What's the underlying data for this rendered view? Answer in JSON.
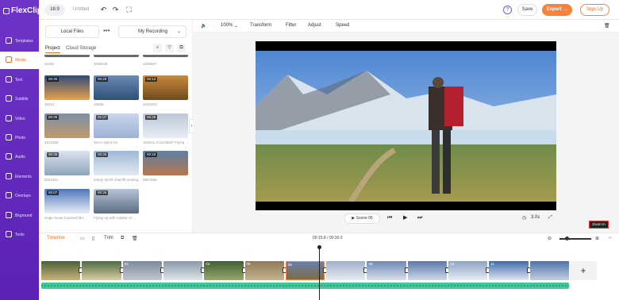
{
  "app": {
    "name": "FlexClip"
  },
  "sidebar": {
    "items": [
      {
        "label": "Templates",
        "icon": "template-icon"
      },
      {
        "label": "Media",
        "icon": "media-icon",
        "active": true
      },
      {
        "label": "Text",
        "icon": "text-icon"
      },
      {
        "label": "Subtitle",
        "icon": "subtitle-icon"
      },
      {
        "label": "Video",
        "icon": "video-icon"
      },
      {
        "label": "Photo",
        "icon": "photo-icon"
      },
      {
        "label": "Audio",
        "icon": "audio-icon"
      },
      {
        "label": "Elements",
        "icon": "elements-icon"
      },
      {
        "label": "Overlays",
        "icon": "overlays-icon"
      },
      {
        "label": "Bkground",
        "icon": "background-icon"
      },
      {
        "label": "Tools",
        "icon": "tools-icon"
      }
    ]
  },
  "topbar": {
    "ratio": "16:9",
    "title": "Untitled",
    "undo": "↶",
    "redo": "↷",
    "fullscreen": "⛶",
    "help": "?",
    "save": "Save",
    "export": "Export →",
    "signup": "Sign Up"
  },
  "panel": {
    "local_files": "Local Files",
    "more": "•••",
    "my_recording": "My Recording",
    "chevron": "⌄",
    "tabs": [
      "Project",
      "Cloud Storage"
    ],
    "tools": [
      "⌕",
      "▽",
      "⧉"
    ],
    "collapse": "‹",
    "top_caps": [
      "34262",
      "3039349",
      "2269587"
    ],
    "items": [
      {
        "dur": "00:30",
        "cap": "35431",
        "c1": "#2f4c7a",
        "c2": "#e9a14a"
      },
      {
        "dur": "00:29",
        "cap": "15808",
        "c1": "#6b8ab8",
        "c2": "#2f4f72"
      },
      {
        "dur": "00:13",
        "cap": "3192303",
        "c1": "#c98a3b",
        "c2": "#6d4a1e"
      },
      {
        "dur": "00:36",
        "cap": "2541559",
        "c1": "#7a8fa8",
        "c2": "#c39a6b"
      },
      {
        "dur": "01:07",
        "cap": "Sun Ii Spirit On",
        "c1": "#c7d4ec",
        "c2": "#9fb1d8"
      },
      {
        "dur": "00:25",
        "cap": "AERIAL COLOBUF Flying ...",
        "c1": "#bcc8d6",
        "c2": "#e8eef5"
      },
      {
        "dur": "00:35",
        "cap": "5323411",
        "c1": "#dbe3ec",
        "c2": "#8fa4bc"
      },
      {
        "dur": "00:30",
        "cap": "empty ski lift chairlift moving...",
        "c1": "#9fb8d8",
        "c2": "#e3e9ef"
      },
      {
        "dur": "00:18",
        "cap": "6557569",
        "c1": "#5f7fa6",
        "c2": "#b7764a"
      },
      {
        "dur": "00:07",
        "cap": "Huge Snow Covered Mo...",
        "c1": "#4d76b8",
        "c2": "#e8eef6"
      },
      {
        "dur": "00:26",
        "cap": "Flying up with rotation in ...",
        "c1": "#b6c4d6",
        "c2": "#5c6d80"
      }
    ]
  },
  "editor": {
    "volume": "🔈",
    "zoom": "100%",
    "zoom_chev": "⌄",
    "transform": "Transform",
    "filter": "Filter",
    "adjust": "Adjust",
    "speed": "Speed",
    "trash": "🗑",
    "scene_play": "▶",
    "scene": "Scene 06",
    "prev": "⏮",
    "play": "▶",
    "next": "⏭",
    "duration": "3.0s",
    "timer": "◷",
    "fit": "⤢"
  },
  "timeline": {
    "tab": "Timeline",
    "trim": "Trim",
    "time": "00:15.8 / 00:30.0",
    "zoom_tip": "Zoom In",
    "zoom_out": "⊖",
    "zoom_in": "⊕",
    "expand": "⇔",
    "clips": [
      {
        "label": "",
        "c1": "#49633a",
        "c2": "#c9b27a",
        "w": 1
      },
      {
        "label": "",
        "c1": "#4d6b3d",
        "c2": "#d8cfa8",
        "w": 1
      },
      {
        "label": "03",
        "c1": "#7d8a9c",
        "c2": "#c1c7cf",
        "w": 1
      },
      {
        "label": "",
        "c1": "#869aa8",
        "c2": "#dfe5ea",
        "w": 1
      },
      {
        "label": "04",
        "c1": "#405f33",
        "c2": "#9aa86b",
        "w": 1
      },
      {
        "label": "05",
        "c1": "#8f7a5a",
        "c2": "#c5b28d",
        "w": 1
      },
      {
        "label": "06",
        "c1": "#6a7fa8",
        "c2": "#7d6b46",
        "w": 1,
        "selected": true
      },
      {
        "label": "",
        "c1": "#9fb0c8",
        "c2": "#e6ebf1",
        "w": 1
      },
      {
        "label": "08",
        "c1": "#6e89b5",
        "c2": "#d7dfe9",
        "w": 1
      },
      {
        "label": "",
        "c1": "#5978ac",
        "c2": "#cfd9e6",
        "w": 1
      },
      {
        "label": "10",
        "c1": "#8aa3c4",
        "c2": "#e8edf3",
        "w": 1
      },
      {
        "label": "11",
        "c1": "#3f6aa8",
        "c2": "#dfe7f1",
        "w": 1
      },
      {
        "label": "",
        "c1": "#4d72aa",
        "c2": "#c3cfdf",
        "w": 1
      }
    ],
    "add": "+"
  }
}
